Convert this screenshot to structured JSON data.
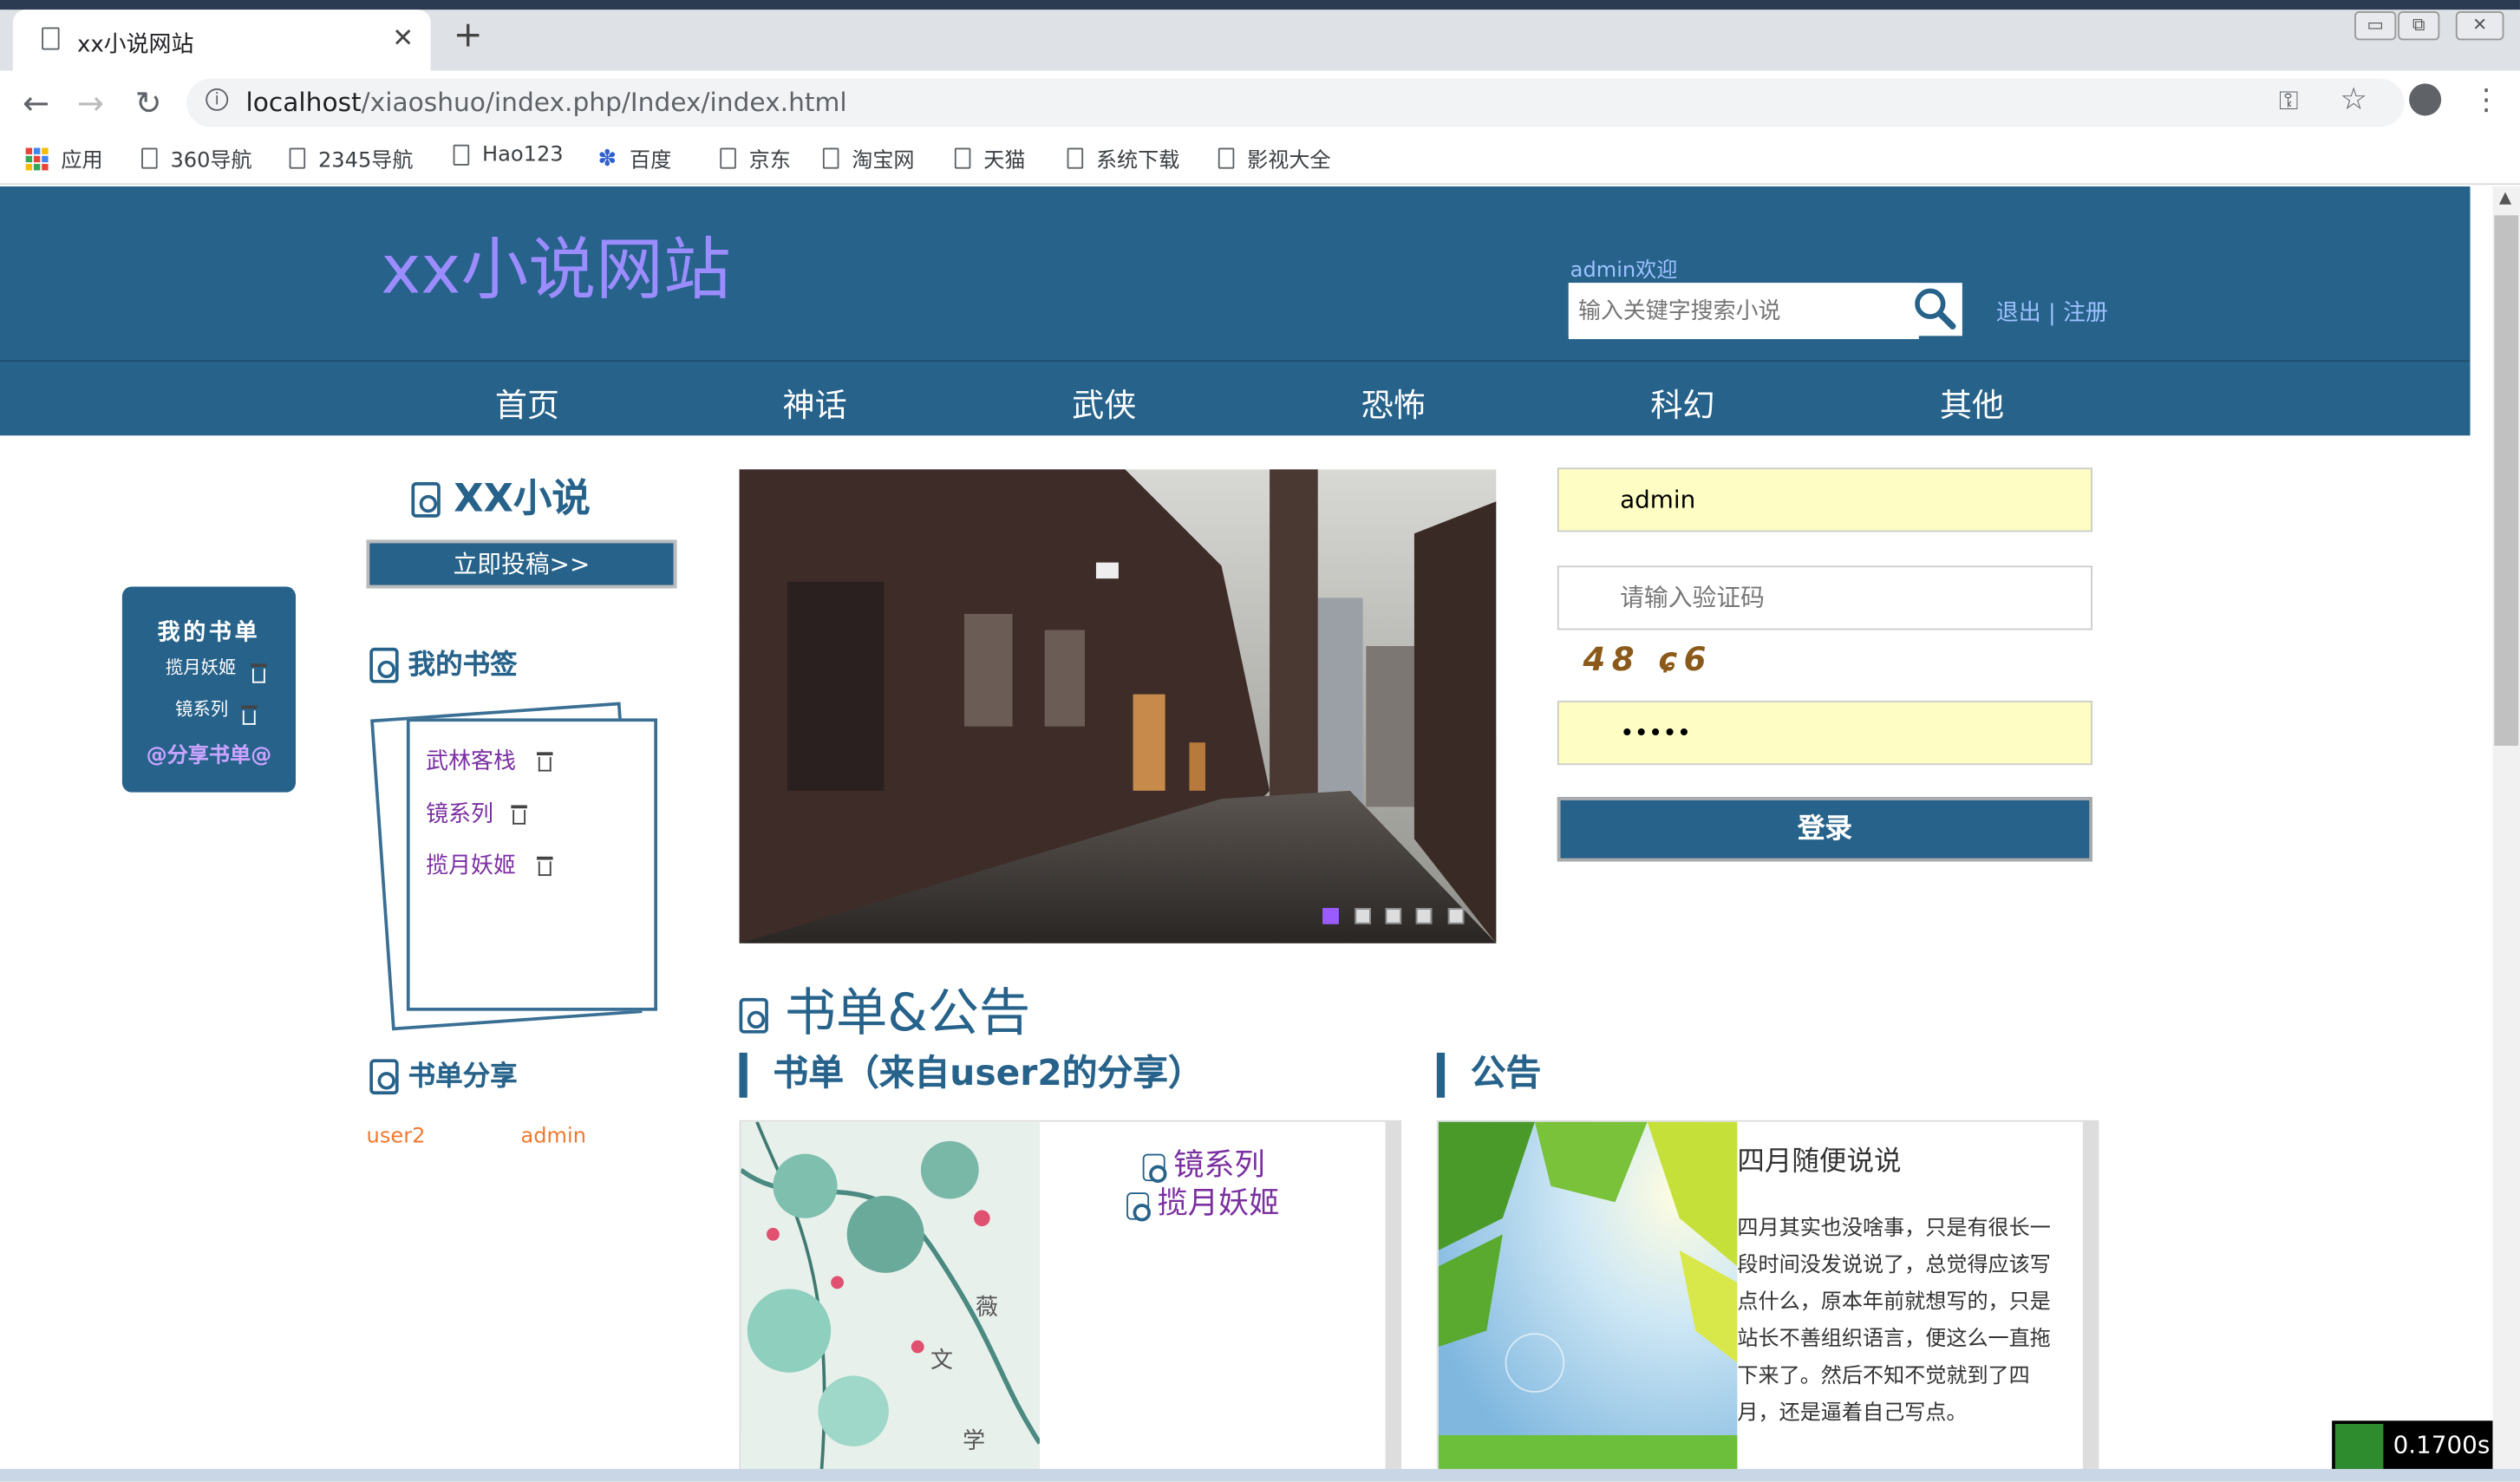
{
  "browser": {
    "tab_title": "xx小说网站",
    "url_host": "localhost",
    "url_path": "/xiaoshuo/index.php/Index/index.html",
    "bookmarks": [
      "应用",
      "360导航",
      "2345导航",
      "Hao123",
      "百度",
      "京东",
      "淘宝网",
      "天猫",
      "系统下载",
      "影视大全"
    ]
  },
  "header": {
    "logo": "xx小说网站",
    "welcome": "admin欢迎",
    "search_placeholder": "输入关键字搜索小说",
    "logout": "退出",
    "separator": "|",
    "register": "注册"
  },
  "nav": [
    "首页",
    "神话",
    "武侠",
    "恐怖",
    "科幻",
    "其他"
  ],
  "my_books_panel": {
    "title": "我的书单",
    "books": [
      "揽月妖姬",
      "镜系列"
    ],
    "share": "@分享书单@"
  },
  "sidebar": {
    "title": "XX小说",
    "submit": "立即投稿>>",
    "bookmarks_title": "我的书签",
    "bookmarks": [
      "武林客栈",
      "镜系列",
      "揽月妖姬"
    ],
    "share_title": "书单分享",
    "sharers": [
      "user2",
      "admin"
    ]
  },
  "carousel": {
    "dots": 5,
    "active": 0
  },
  "login": {
    "username": "admin",
    "captcha_placeholder": "请输入验证码",
    "captcha_text": "48 ɕ6",
    "password": "•••••",
    "login_button": "登录"
  },
  "notice": {
    "title": "书单&公告",
    "list_header": "书单（来自user2的分享）",
    "list_items": [
      "镜系列",
      "揽月妖姬"
    ],
    "list_image_text": [
      "薇",
      "文",
      "学"
    ],
    "announce_header": "公告",
    "announce_title": "四月随便说说",
    "announce_body": "四月其实也没啥事，只是有很长一段时间没发说说了，总觉得应该写点什么，原本年前就想写的，只是站长不善组织语言，便这么一直拖下来了。然后不知不觉就到了四月，还是逼着自己写点。"
  },
  "timer": "0.1700s",
  "colors": {
    "primary": "#26628a",
    "logo": "#9b8cff",
    "link": "#7a2fa0",
    "sharer": "#ee7a30",
    "input_fill": "#fdfdc4"
  }
}
